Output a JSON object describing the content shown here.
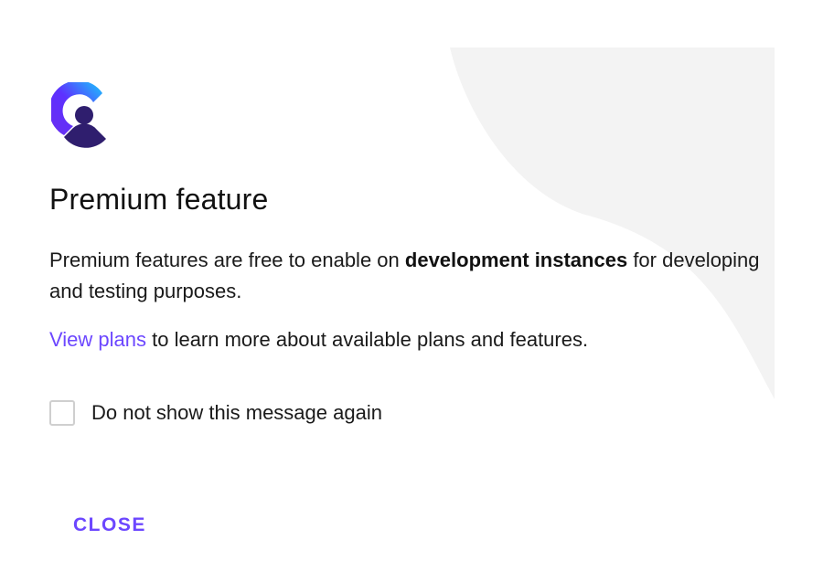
{
  "logo": {
    "icon": "clerk-logo-icon",
    "colors": [
      "#17ccfc",
      "#5d31ff",
      "#2f1e6e"
    ]
  },
  "dialog": {
    "title": "Premium feature",
    "description_before": "Premium features are free to enable on ",
    "description_bold": "development instances",
    "description_after": " for developing and testing purposes.",
    "plans_link": "View plans",
    "plans_text": " to learn more about available plans and features.",
    "checkbox_label": "Do not show this message again",
    "checkbox_checked": false,
    "close_label": "CLOSE"
  },
  "colors": {
    "accent": "#6c47ff",
    "background_shape": "#f3f3f3"
  }
}
